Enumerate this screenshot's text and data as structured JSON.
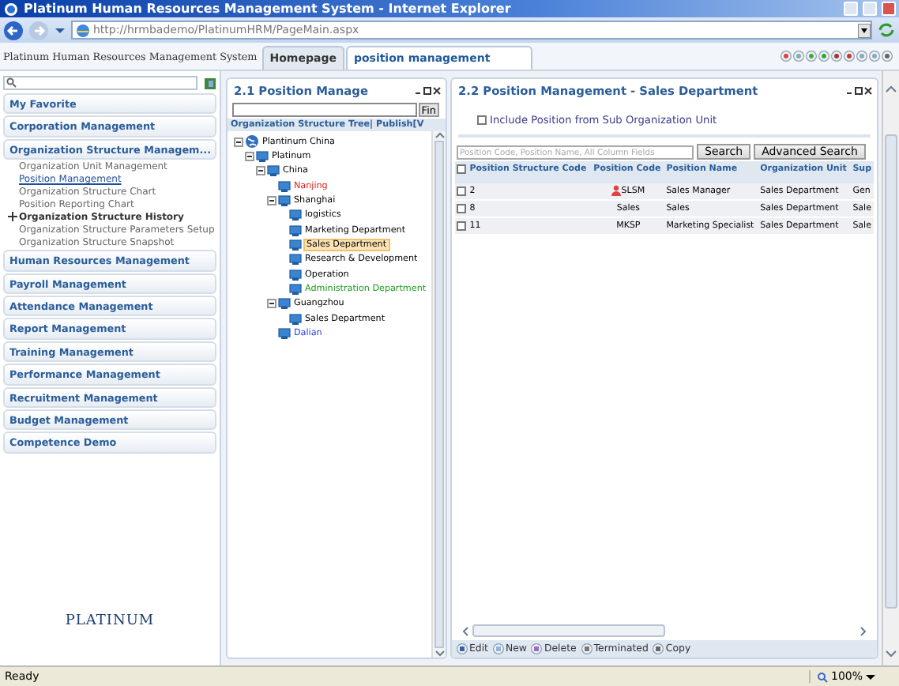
{
  "window": {
    "title": "Platinum Human Resources Management System - Internet Explorer"
  },
  "address_bar": {
    "url": "http://hrmbademo/PlatinumHRM/PageMain.aspx"
  },
  "app": {
    "title": "Platinum Human Resources Management System",
    "tabs": [
      {
        "label": "Homepage",
        "selected": false
      },
      {
        "label": "position management",
        "selected": true
      }
    ]
  },
  "sidebar": {
    "logo": "PLATINUM",
    "groups": [
      {
        "label": "My Favorite"
      },
      {
        "label": "Corporation Management"
      },
      {
        "label": "Organization Structure Managem...",
        "items": [
          {
            "label": "Organization Unit Management",
            "kind": "link",
            "selected": false
          },
          {
            "label": "Position Management",
            "kind": "link",
            "selected": true
          },
          {
            "label": "Organization Structure Chart",
            "kind": "link",
            "selected": false
          },
          {
            "label": "Position Reporting Chart",
            "kind": "link",
            "selected": false
          },
          {
            "label": "Organization Structure History",
            "kind": "folder",
            "selected": false
          },
          {
            "label": "Organization Structure Parameters Setup",
            "kind": "link",
            "selected": false
          },
          {
            "label": "Organization Structure Snapshot",
            "kind": "link",
            "selected": false
          }
        ]
      },
      {
        "label": "Human Resources Management"
      },
      {
        "label": "Payroll Management"
      },
      {
        "label": "Attendance Management"
      },
      {
        "label": "Report Management"
      },
      {
        "label": "Training Management"
      },
      {
        "label": "Performance Management"
      },
      {
        "label": "Recruitment Management"
      },
      {
        "label": "Budget Management"
      },
      {
        "label": "Competence Demo"
      }
    ]
  },
  "tree_panel": {
    "title": "2.1 Position Manage",
    "find_button": "Fin",
    "header": "Organization Structure Tree| Publish[V",
    "tree": [
      {
        "label": "Plantinum China",
        "kind": "globe",
        "selected": false,
        "expanded": true,
        "children": [
          {
            "label": "Platinum",
            "kind": "unit",
            "selected": false,
            "expanded": true,
            "children": [
              {
                "label": "China",
                "kind": "unit",
                "selected": false,
                "expanded": true,
                "children": [
                  {
                    "label": "Nanjing",
                    "kind": "unit",
                    "color": "#e0201a",
                    "selected": false
                  },
                  {
                    "label": "Shanghai",
                    "kind": "unit",
                    "selected": false,
                    "expanded": true,
                    "children": [
                      {
                        "label": "logistics",
                        "kind": "unit",
                        "selected": false
                      },
                      {
                        "label": "Marketing Department",
                        "kind": "unit",
                        "selected": false
                      },
                      {
                        "label": "Sales Department",
                        "kind": "unit",
                        "selected": true
                      },
                      {
                        "label": "Research & Development",
                        "kind": "unit",
                        "selected": false
                      },
                      {
                        "label": "Operation",
                        "kind": "unit",
                        "selected": false
                      },
                      {
                        "label": "Administration Department",
                        "kind": "unit",
                        "color": "#1e9a1e",
                        "selected": false
                      }
                    ]
                  },
                  {
                    "label": "Guangzhou",
                    "kind": "unit",
                    "selected": false,
                    "expanded": true,
                    "children": [
                      {
                        "label": "Sales Department",
                        "kind": "unit",
                        "selected": false
                      }
                    ]
                  },
                  {
                    "label": "Dalian",
                    "kind": "unit",
                    "color": "#2a3ce8",
                    "selected": false
                  }
                ]
              }
            ]
          }
        ]
      }
    ]
  },
  "grid_panel": {
    "title": "2.2 Position Management - Sales Department",
    "include_sub": {
      "label": "Include Position from Sub Organization Unit",
      "checked": false
    },
    "search": {
      "placeholder": "Position Code, Position Name, All Column Fields"
    },
    "buttons": [
      "Search",
      "Advanced Search"
    ],
    "table": {
      "select_all_checked": false,
      "columns": [
        "Position Structure Code",
        "Position Code",
        "Position Name",
        "Organization Unit",
        "Sup"
      ],
      "rows": [
        {
          "checked": false,
          "manager": true,
          "cells": [
            "2",
            "SLSM",
            "Sales Manager",
            "Sales Department",
            "Gen"
          ]
        },
        {
          "checked": false,
          "manager": false,
          "cells": [
            "8",
            "Sales",
            "Sales",
            "Sales Department",
            "Sale"
          ]
        },
        {
          "checked": false,
          "manager": false,
          "cells": [
            "11",
            "MKSP",
            "Marketing Specialist",
            "Sales Department",
            "Sale"
          ]
        }
      ]
    },
    "toolbar": [
      "Edit",
      "New",
      "Delete",
      "Terminated",
      "Copy"
    ]
  },
  "status_bar": {
    "text": "Ready",
    "zoom": "100%"
  }
}
